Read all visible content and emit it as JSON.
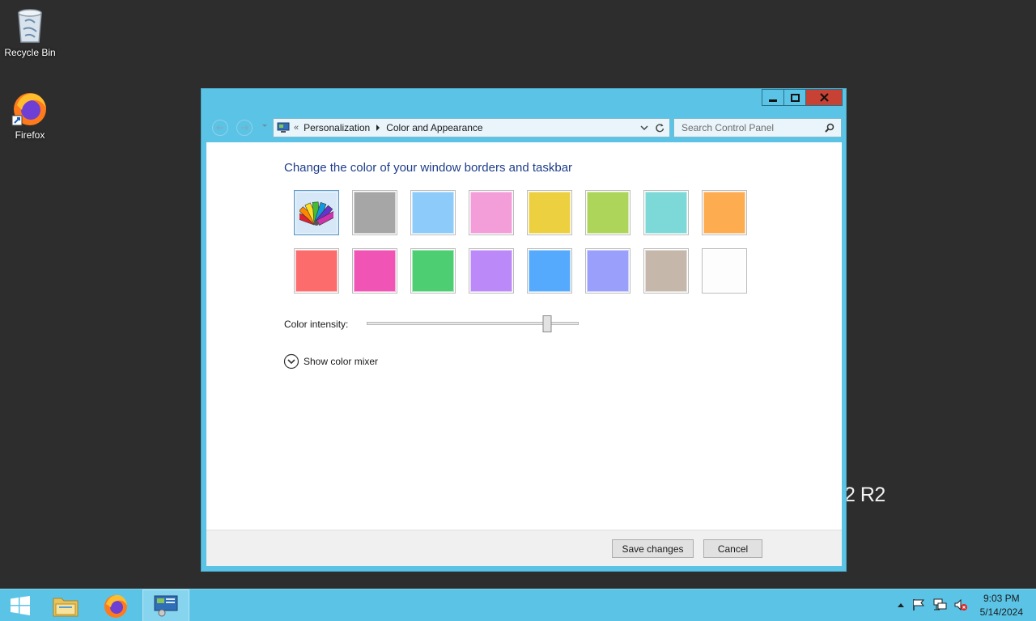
{
  "desktop": {
    "icons": [
      {
        "label": "Recycle Bin",
        "icon": "recycle-bin-icon"
      },
      {
        "label": "Firefox",
        "icon": "firefox-icon"
      }
    ],
    "watermark_fragment": "2 R2"
  },
  "window": {
    "controls": {
      "minimize": "minimize-icon",
      "maximize": "maximize-icon",
      "close": "close-icon"
    },
    "address_bar": {
      "prefix": "«",
      "breadcrumbs": [
        "Personalization",
        "Color and Appearance"
      ]
    },
    "search": {
      "placeholder": "Search Control Panel"
    },
    "heading": "Change the color of your window borders and taskbar",
    "swatches": [
      {
        "name": "automatic",
        "color": "#d6e8f7",
        "selected": true
      },
      {
        "name": "sky-gray",
        "color": "#a6a6a6"
      },
      {
        "name": "sky-blue",
        "color": "#8ccbfa"
      },
      {
        "name": "pink",
        "color": "#f39ed9"
      },
      {
        "name": "yellow",
        "color": "#edd040"
      },
      {
        "name": "lime",
        "color": "#add55a"
      },
      {
        "name": "teal",
        "color": "#7cd9d8"
      },
      {
        "name": "orange",
        "color": "#fdac50"
      },
      {
        "name": "red",
        "color": "#fd6c6c"
      },
      {
        "name": "magenta",
        "color": "#f054b4"
      },
      {
        "name": "green",
        "color": "#4ece72"
      },
      {
        "name": "violet",
        "color": "#bc8af8"
      },
      {
        "name": "blue",
        "color": "#55aafd"
      },
      {
        "name": "periwinkle",
        "color": "#9a9ffc"
      },
      {
        "name": "taupe",
        "color": "#c5b8ab"
      },
      {
        "name": "white",
        "color": "#fdfdfd"
      }
    ],
    "intensity": {
      "label": "Color intensity:",
      "value": 0.85
    },
    "mixer_toggle": "Show color mixer",
    "buttons": {
      "save": "Save changes",
      "cancel": "Cancel"
    }
  },
  "taskbar": {
    "items": [
      "start-icon",
      "file-explorer-icon",
      "firefox-icon",
      "control-panel-icon"
    ],
    "tray": [
      "chevron-up-icon",
      "flag-icon",
      "network-icon",
      "speaker-muted-icon"
    ],
    "clock": {
      "time": "9:03 PM",
      "date": "5/14/2024"
    }
  }
}
